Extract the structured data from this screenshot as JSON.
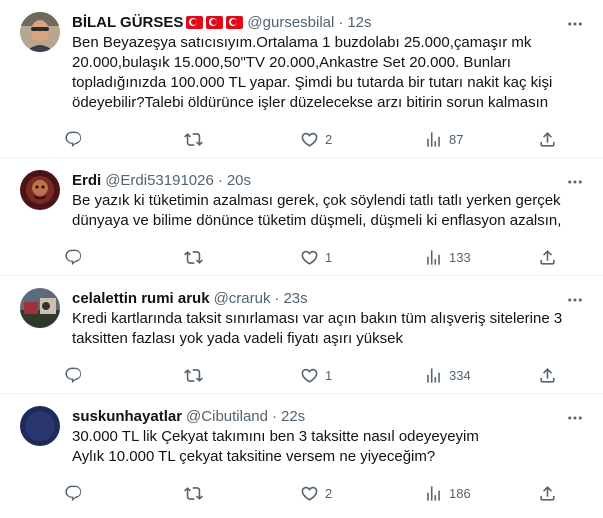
{
  "tweets": [
    {
      "name": "BİLAL GÜRSES",
      "handle": "@gursesbilal",
      "time": "12s",
      "text": "Ben Beyazeşya satıcısıyım.Ortalama 1 buzdolabı 25.000,çamaşır mk\n20.000,bulaşık 15.000,50\"TV 20.000,Ankastre Set 20.000. Bunları\ntopladığınızda 100.000 TL yapar. Şimdi bu tutarda bir tutarı nakit kaç kişi\nödeyebilir?Talebi öldürünce işler düzelecekse arzı bitirin sorun kalmasın",
      "reply_count": "",
      "retweet_count": "",
      "like_count": "2",
      "view_count": "87"
    },
    {
      "name": "Erdi",
      "handle": "@Erdi53191026",
      "time": "20s",
      "text": "Be yazık ki tüketimin azalması gerek, çok söylendi tatlı tatlı yerken gerçek\ndünyaya ve bilime dönünce tüketim düşmeli, düşmeli ki enflasyon azalsın,",
      "reply_count": "",
      "retweet_count": "",
      "like_count": "1",
      "view_count": "133"
    },
    {
      "name": "celalettin rumi aruk",
      "handle": "@craruk",
      "time": "23s",
      "text": "Kredi kartlarında taksit sınırlaması var açın bakın tüm alışveriş sitelerine 3\ntaksitten fazlası yok yada vadeli fiyatı aşırı yüksek",
      "reply_count": "",
      "retweet_count": "",
      "like_count": "1",
      "view_count": "334"
    },
    {
      "name": "suskunhayatlar",
      "handle": "@Cibutiland",
      "time": "22s",
      "text": "30.000 TL lik Çekyat takımını ben 3 taksitte nasıl odeyeyeyim\nAylık 10.000 TL çekyat taksitine versem ne yiyeceğim?",
      "reply_count": "",
      "retweet_count": "",
      "like_count": "2",
      "view_count": "186"
    }
  ],
  "icons": {
    "more": "more-icon",
    "reply": "reply-icon",
    "retweet": "retweet-icon",
    "like": "heart-icon",
    "views": "views-icon",
    "share": "share-icon",
    "flag": "turkish-flag-icon"
  },
  "colors": {
    "text": "#0f1419",
    "muted": "#536471",
    "divider": "#eff3f4",
    "flag": "#e30a17"
  }
}
